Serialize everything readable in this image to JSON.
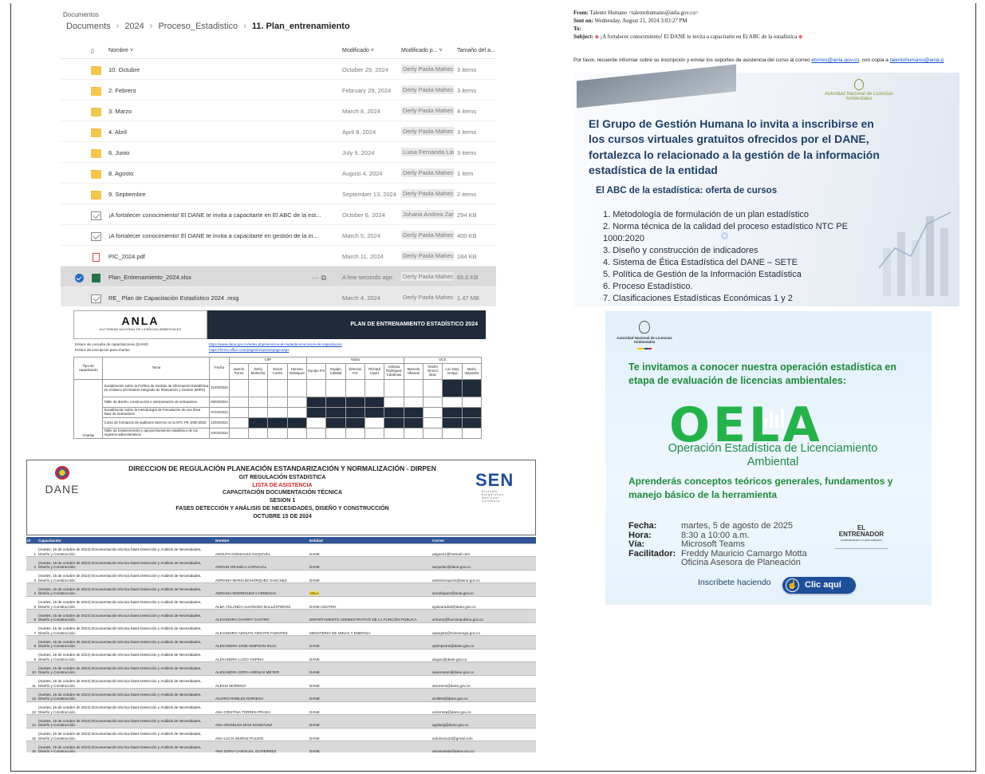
{
  "explorer": {
    "root": "Documentos",
    "breadcrumbs": [
      "Documents",
      "2024",
      "Proceso_Estadistico",
      "11. Plan_entrenamiento"
    ],
    "columns": {
      "name": "Nombre",
      "modified": "Modificado",
      "modified_by": "Modificado p...",
      "size": "Tamaño del a..."
    },
    "rows": [
      {
        "name": "10. Octubre",
        "date": "October 29, 2024",
        "by": "Derly Paola Mahecha",
        "size": "3 items",
        "type": "folder"
      },
      {
        "name": "2. Febrero",
        "date": "February 29, 2024",
        "by": "Derly Paola Mahecha",
        "size": "3 items",
        "type": "folder"
      },
      {
        "name": "3. Marzo",
        "date": "March 8, 2024",
        "by": "Derly Paola Mahecha",
        "size": "4 items",
        "type": "folder"
      },
      {
        "name": "4. Abril",
        "date": "April 8, 2024",
        "by": "Derly Paola Mahecha",
        "size": "3 items",
        "type": "folder"
      },
      {
        "name": "6. Junio",
        "date": "July 9, 2024",
        "by": "Luisa Fernanda Lanch",
        "size": "3 items",
        "type": "folder"
      },
      {
        "name": "8. Agosto",
        "date": "August 4, 2024",
        "by": "Derly Paola Mahecha",
        "size": "1 item",
        "type": "folder"
      },
      {
        "name": "9. Septiembre",
        "date": "September 13, 2024",
        "by": "Derly Paola Mahecha",
        "size": "2 items",
        "type": "folder"
      },
      {
        "name": "¡A fortalecer conocimiento! El DANE te invita a capacitarte en El ABC de la est...",
        "date": "October 6, 2024",
        "by": "Johana Andrea Zambi",
        "size": "294 KB",
        "type": "mail"
      },
      {
        "name": "¡A fortalecer conocimiento! El DANE te invita a capacitarte en gestión de la in...",
        "date": "March 5, 2024",
        "by": "Derly Paola Mahecha",
        "size": "400 KB",
        "type": "mail"
      },
      {
        "name": "PIC_2024.pdf",
        "date": "March 11, 2024",
        "by": "Derly Paola Mahecha",
        "size": "184 KB",
        "type": "pdf"
      },
      {
        "name": "Plan_Entrenamiento_2024.xlsx",
        "date": "A few seconds ago",
        "by": "Derly Paola Mahecha",
        "size": "65.0 KB",
        "type": "xlsx"
      },
      {
        "name": "RE_ Plan de Capacitación Estadístico 2024 .msg",
        "date": "March 4, 2024",
        "by": "Derly Paola Mahecha",
        "size": "1.47 MB",
        "type": "mail"
      }
    ]
  },
  "email": {
    "from_label": "From:",
    "from": "Talento Humano <talentohumano@anla.gov.co>",
    "sent_label": "Sent on:",
    "sent": "Wednesday, August 21, 2024 3:03:27 PM",
    "to_label": "To:",
    "to": "",
    "subject_label": "Subject:",
    "subject": "¡A fortalecer conocimiento! El DANE te invita a capacitarte en El ABC de la estadística",
    "body_pre": "Por favor, recuerde informar sobre su inscripción y enviar los soportes de asistencia del curso al correo ",
    "link1": "etorres@anla.gov.co",
    "body_mid": ", con copia a ",
    "link2": "talentohumano@anla.g",
    "poster": {
      "logo_text": "Autoridad Nacional de Licencias Ambientales",
      "title": "El Grupo de Gestión Humana lo invita a inscribirse en los cursos virtuales gratuitos ofrecidos por el DANE, fortalezca lo relacionado a la gestión de la información estadística de la entidad",
      "subtitle": "El ABC de la estadística: oferta de cursos",
      "courses": [
        "1. Metodología de formulación de un plan estadístico",
        "2. Norma técnica de la calidad del proceso estadístico NTC PE 1000:2020",
        "3. Diseño y construcción de indicadores",
        "4. Sistema de Ética Estadística del DANE – SETE",
        "5. Política de Gestión de la Información Estadística",
        "6. Proceso Estadístico.",
        "7. Clasificaciones Estadísticas Económicas 1 y 2"
      ]
    }
  },
  "sheet": {
    "brand": "ANLA",
    "brand_tag": "AUTORIDAD NACIONAL DE LICENCIAS AMBIENTALES",
    "band_title": "PLAN DE ENTRENAMIENTO ESTADÍSTICO 2024",
    "link_label_1": "Enlace de consulta de capacitaciones (DANE)",
    "link_1": "https://www.dane.gov.co/index.php/servicios-al-ciudadano/servicios-de-capacitacion",
    "link_label_2": "Enlace de inscripción para charlas:",
    "link_2": "https://forms.office.com/pages/responsepage.aspx",
    "header": {
      "type": "Tipo de capacitación",
      "theme": "Tema",
      "date": "Fecha",
      "groups": [
        "CIIP",
        "Todos",
        "OCS"
      ],
      "people": [
        "Jazmín Torres",
        "Derly Mahecha",
        "Yeison Cortés",
        "Honorio Velásquez",
        "Equipo FAI",
        "Equipo Calidad",
        "Directos FAI",
        "Richard López",
        "Adriana Rodríguez Cárdenas",
        "Marcela Villareal",
        "Yenifer Orozco Díaz",
        "Luz Dary Amaya",
        "María Alejandra"
      ]
    },
    "rows": [
      {
        "theme": "Socialización sobre la Política de Gestión de Información Estadística en el Marco del Modelo Integrado de Planeación y Gestión (MIPG)",
        "date": "21/02/2024"
      },
      {
        "theme": "Taller de diseño, construcción e interpretación de indicadores",
        "date": "06/03/2024"
      },
      {
        "theme": "Socialización sobre la metodología de formulación de una línea base de indicadores",
        "date": "07/03/2024"
      },
      {
        "theme": "Curso de formación de auditores internos en la NTC PE 1000:2020",
        "date": "12/03/2024"
      },
      {
        "theme": "Taller de fortalecimiento y aprovechamiento estadístico de los registros administrativos",
        "date": "04/04/2024"
      }
    ],
    "row_type": "Charlas"
  },
  "oela": {
    "authority": "Autoridad Nacional de Licencias Ambientales",
    "invite": "Te invitamos a conocer nuestra operación estadística en etapa de evaluación de licencias ambientales:",
    "acronym": "OELA",
    "opname": "Operación Estadística de Licenciamiento Ambiental",
    "learn": "Aprenderás conceptos teóricos generales, fundamentos y manejo básico de la herramienta",
    "details": [
      {
        "label": "Fecha:",
        "value": "martes, 5 de agosto de 2025"
      },
      {
        "label": "Hora:",
        "value": "8:30 a 10:00 a.m."
      },
      {
        "label": "Vía:",
        "value": "Microsoft Teams"
      },
      {
        "label": "Facilitador:",
        "value": "Freddy Mauricio Camargo Motta"
      },
      {
        "label": "",
        "value": "Oficina Asesora de Planeación"
      }
    ],
    "badge": "EL ENTRENADOR",
    "badge_sub": "COMPARTIENDO LO QUE SABEMOS",
    "cta_text": "Inscríbete haciendo",
    "cta_button": "Clic aquí"
  },
  "attendance": {
    "dane": "DANE",
    "sen": "SEN",
    "sen_sub": "Sistema Estadístico Nacional Colombia",
    "lines": [
      "DIRECCION DE REGULACIÓN PLANEACIÓN ESTANDARIZACIÓN Y NORMALIZACIÓN - DIRPEN",
      "GIT REGULACIÓN ESTADISTICA",
      "LISTA DE ASISTENCIA",
      "CAPACITACIÓN DOCUMENTACIÓN TÉCNICA",
      "SESION 1",
      "FASES DETECCIÓN Y ANÁLISIS DE NECESIDADES, DISEÑO Y CONSTRUCCIÓN",
      "OCTUBRE 15 DE 2024"
    ],
    "columns": [
      "Id",
      "Capacitación",
      "Nombre",
      "Entidad",
      "Correo"
    ],
    "training": "(martes, 15 de octubre de 2024) Documentación técnica fases Detección y Análisis de Necesidades, Diseño y Construcción.",
    "rows": [
      {
        "id": "1",
        "name": "ADOLFO GONZALEZ ESQUIVEL",
        "entity": "DANE",
        "email": "adgoes1@hotmail.com"
      },
      {
        "id": "2",
        "name": "ADRIAN ORJUELA CARVAJAL",
        "entity": "DANE",
        "email": "aorjuelac@dane.gov.co"
      },
      {
        "id": "3",
        "name": "ADRIANA MARIA BOHORQUEZ SANCHEZ",
        "entity": "DANE",
        "email": "ambohorquezs@dane.gov.co"
      },
      {
        "id": "4",
        "name": "ADRIANA RODRIGUEZ CARDENAS",
        "entity": "ANLA",
        "email": "acrodriguez@anla.gov.co"
      },
      {
        "id": "5",
        "name": "ALBA YOLANDA ALVARADO BALLESTEROS",
        "entity": "DANE CENTRO",
        "email": "ayalvaradob@dane.gov.co"
      },
      {
        "id": "6",
        "name": "ALEJANDRA CHARRY CASTRO",
        "entity": "DEPARTAMENTO ADMINISTRATIVO DE LA FUNCIÓN PÚBLICA",
        "email": "acharry@funcionpublica.gov.co"
      },
      {
        "id": "7",
        "name": "ALEJANDRO ADOLFO ARGOTE FUENTES",
        "entity": "MINISTERIO DE MINAS Y ENERGIA",
        "email": "aaargote@minenergia.gov.co"
      },
      {
        "id": "8",
        "name": "ALEXANDRA JANE SIMPSON SILVA",
        "entity": "DANE",
        "email": "ajsimpsons@dane.gov.co"
      },
      {
        "id": "9",
        "name": "ALEXANDRA LUGO OSPINA",
        "entity": "DANE",
        "email": "alugoo@dane.gov.co"
      },
      {
        "id": "10",
        "name": "ALEXANDRA SOFIA ARENAS MEYER",
        "entity": "DANE",
        "email": "asarenasm@dane.gov.co"
      },
      {
        "id": "11",
        "name": "ALEXIS MORENO",
        "entity": "DANE",
        "email": "amoreno@dane.gov.co"
      },
      {
        "id": "12",
        "name": "ALVARO ROBLES NORIEGA",
        "entity": "DANE",
        "email": "arobles@dane.gov.co"
      },
      {
        "id": "13",
        "name": "ANA CRISTINA TORRES PRADA",
        "entity": "DANE",
        "email": "actorresp@dane.gov.co"
      },
      {
        "id": "14",
        "name": "ANA GRISELDA DÍAZ GONZÁLEZ",
        "entity": "DANE",
        "email": "agdiazg@dane.gov.co"
      },
      {
        "id": "15",
        "name": "ANA LUCIA MUÑOZ PULIDO",
        "entity": "DANE",
        "email": "anlumuzu33@gmail.com"
      },
      {
        "id": "16",
        "name": "ANA SOFIA CARVAJAL GUTIERREZ",
        "entity": "DANE",
        "email": "ascarvajalg@dane.gov.co"
      }
    ]
  }
}
